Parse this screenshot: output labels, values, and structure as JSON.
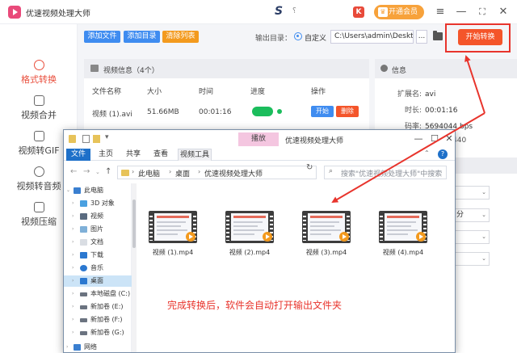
{
  "app": {
    "title": "优速视频处理大师",
    "brand_letter": "S",
    "brand_q": "؟",
    "k_badge": "K",
    "vip_label": "开通会员",
    "vip_crown": "♛"
  },
  "window_controls": {
    "menu": "≡",
    "minimize": "—",
    "maximize": "⛶",
    "close": "✕"
  },
  "sidebar": {
    "items": [
      {
        "label": "格式转换",
        "active": true
      },
      {
        "label": "视频合并"
      },
      {
        "label": "视频转GIF"
      },
      {
        "label": "视频转音频"
      },
      {
        "label": "视频压缩"
      }
    ]
  },
  "toolbar": {
    "add_file": "添加文件",
    "add_dir": "添加目录",
    "clear_list": "清除列表",
    "output_label": "输出目录：",
    "custom_label": "自定义",
    "output_path": "C:\\Users\\admin\\Desktop",
    "more": "...",
    "start": "开始转换"
  },
  "video_info": {
    "header": "视频信息（4个）",
    "columns": [
      "文件名称",
      "大小",
      "时间",
      "进度",
      "操作"
    ],
    "row": {
      "name": "视频 (1).avi",
      "size": "51.66MB",
      "time": "00:01:16",
      "start": "开始",
      "delete": "删除"
    }
  },
  "info_panel": {
    "header": "信息",
    "ext_label": "扩展名:",
    "ext_value": "avi",
    "time_label": "时长:",
    "time_value": "00:01:16",
    "bitrate_label": "码率:",
    "bitrate_value": "5694044 bps",
    "res_partial": "440",
    "sel2_partial": "分"
  },
  "explorer": {
    "title": "优速视频处理大师",
    "play_tab": "播放",
    "ribbon_tabs": [
      "文件",
      "主页",
      "共享",
      "查看",
      "视频工具"
    ],
    "breadcrumbs": [
      "此电脑",
      "桌面",
      "优速视频处理大师"
    ],
    "search_placeholder": "搜索\"优速视频处理大师\"中搜索",
    "tree": [
      "此电脑",
      "3D 对象",
      "视频",
      "图片",
      "文档",
      "下载",
      "音乐",
      "桌面",
      "本地磁盘 (C:)",
      "新加卷 (E:)",
      "新加卷 (F:)",
      "新加卷 (G:)",
      "网络"
    ],
    "files": [
      "视频 (1).mp4",
      "视频 (2).mp4",
      "视频 (3).mp4",
      "视频 (4).mp4"
    ],
    "annotation": "完成转换后，软件会自动打开输出文件夹"
  },
  "colors": {
    "accent_red": "#e8342c",
    "start_orange": "#f4552a",
    "blue": "#3f8cf0",
    "progress_green": "#1bbd5c"
  }
}
